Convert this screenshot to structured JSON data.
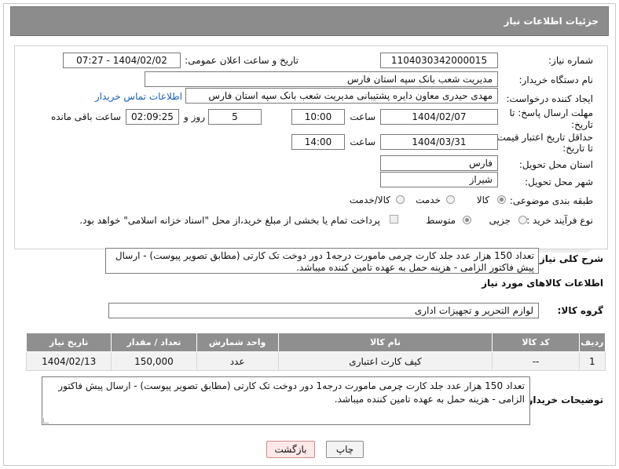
{
  "header": {
    "title": "جزئیات اطلاعات نیاز"
  },
  "form": {
    "need_number_label": "شماره نیاز:",
    "need_number": "1104030342000015",
    "announce_label": "تاریخ و ساعت اعلان عمومی:",
    "announce_value": "1404/02/02 - 07:27",
    "buyer_org_label": "نام دستگاه خریدار:",
    "buyer_org": "مدیریت شعب بانک سپه استان فارس",
    "creator_label": "ایجاد کننده درخواست:",
    "creator": "مهدی حیدری معاون دایره پشتیبانی مدیریت شعب بانک سپه استان فارس",
    "contact_link": "اطلاعات تماس خریدار",
    "reply_deadline_label_1": "مهلت ارسال پاسخ: تا",
    "reply_deadline_label_2": "تاریخ:",
    "reply_date": "1404/02/07",
    "time_label": "ساعت",
    "reply_time": "10:00",
    "days_value": "5",
    "days_label": "روز و",
    "remaining_time": "02:09:25",
    "remaining_label": "ساعت باقی مانده",
    "price_validity_label_1": "حداقل تاریخ اعتبار قیمت:",
    "price_validity_label_2": "تا تاریخ:",
    "price_date": "1404/03/31",
    "price_time": "14:00",
    "province_label": "استان محل تحویل:",
    "province": "فارس",
    "city_label": "شهر محل تحویل:",
    "city": "شیراز",
    "category_label": "طبقه بندی موضوعی:",
    "category_options": [
      "کالا",
      "خدمت",
      "کالا/خدمت"
    ],
    "process_label": "نوع فرآیند خرید :",
    "process_options": [
      "جزیی",
      "متوسط"
    ],
    "payment_note": "پرداخت تمام یا بخشی از مبلغ خرید،از محل \"اسناد خزانه اسلامی\" خواهد بود."
  },
  "summary": {
    "label": "شرح کلی نیاز:",
    "text": "تعداد 150 هزار عدد جلد کارت چرمی مامورت درجه1 دور دوخت تک کارتی (مطابق تصویر پیوست) - ارسال پیش فاکتور الزامی - هزینه حمل به عهده تامین کننده میباشد."
  },
  "goods": {
    "section_title": "اطلاعات کالاهای مورد نیاز",
    "group_label": "گروه کالا:",
    "group_value": "لوازم التحریر و تجهیزات اداری",
    "columns": [
      "ردیف",
      "کد کالا",
      "نام کالا",
      "واحد شمارش",
      "تعداد / مقدار",
      "تاریخ نیاز"
    ],
    "rows": [
      [
        "1",
        "--",
        "کیف کارت اعتباری",
        "عدد",
        "150,000",
        "1404/02/13"
      ]
    ]
  },
  "buyer_notes": {
    "label": "توضیحات خریدار:",
    "text": "تعداد 150 هزار عدد جلد کارت چرمی مامورت درجه1 دور دوخت تک کارتی (مطابق تصویر پیوست) - ارسال پیش فاکتور الزامی - هزینه حمل به عهده تامین کننده میباشد."
  },
  "buttons": {
    "print": "چاپ",
    "back": "بازگشت"
  },
  "colors": {
    "header_bg": "#8c8c8c",
    "table_header_bg": "#8f8f8f",
    "link": "#1a5fb4"
  }
}
